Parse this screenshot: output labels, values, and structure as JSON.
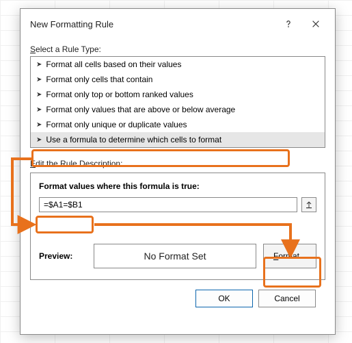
{
  "dialog": {
    "title": "New Formatting Rule",
    "help_aria": "Help",
    "close_aria": "Close"
  },
  "labels": {
    "select_rule_type_pre": "S",
    "select_rule_type_post": "elect a Rule Type:",
    "edit_desc_pre": "E",
    "edit_desc_post": "dit the Rule Description:",
    "format_values_pre": "F",
    "format_values_mid": "o",
    "format_values_post": "rmat values where this formula is true:",
    "preview": "Preview:",
    "no_format": "No Format Set",
    "format_btn_pre": "F",
    "format_btn_post": "ormat...",
    "ok": "OK",
    "cancel": "Cancel"
  },
  "rule_types": [
    "Format all cells based on their values",
    "Format only cells that contain",
    "Format only top or bottom ranked values",
    "Format only values that are above or below average",
    "Format only unique or duplicate values",
    "Use a formula to determine which cells to format"
  ],
  "selected_rule_index": 5,
  "formula": "=$A1=$B1",
  "highlight_color": "#e8711c"
}
